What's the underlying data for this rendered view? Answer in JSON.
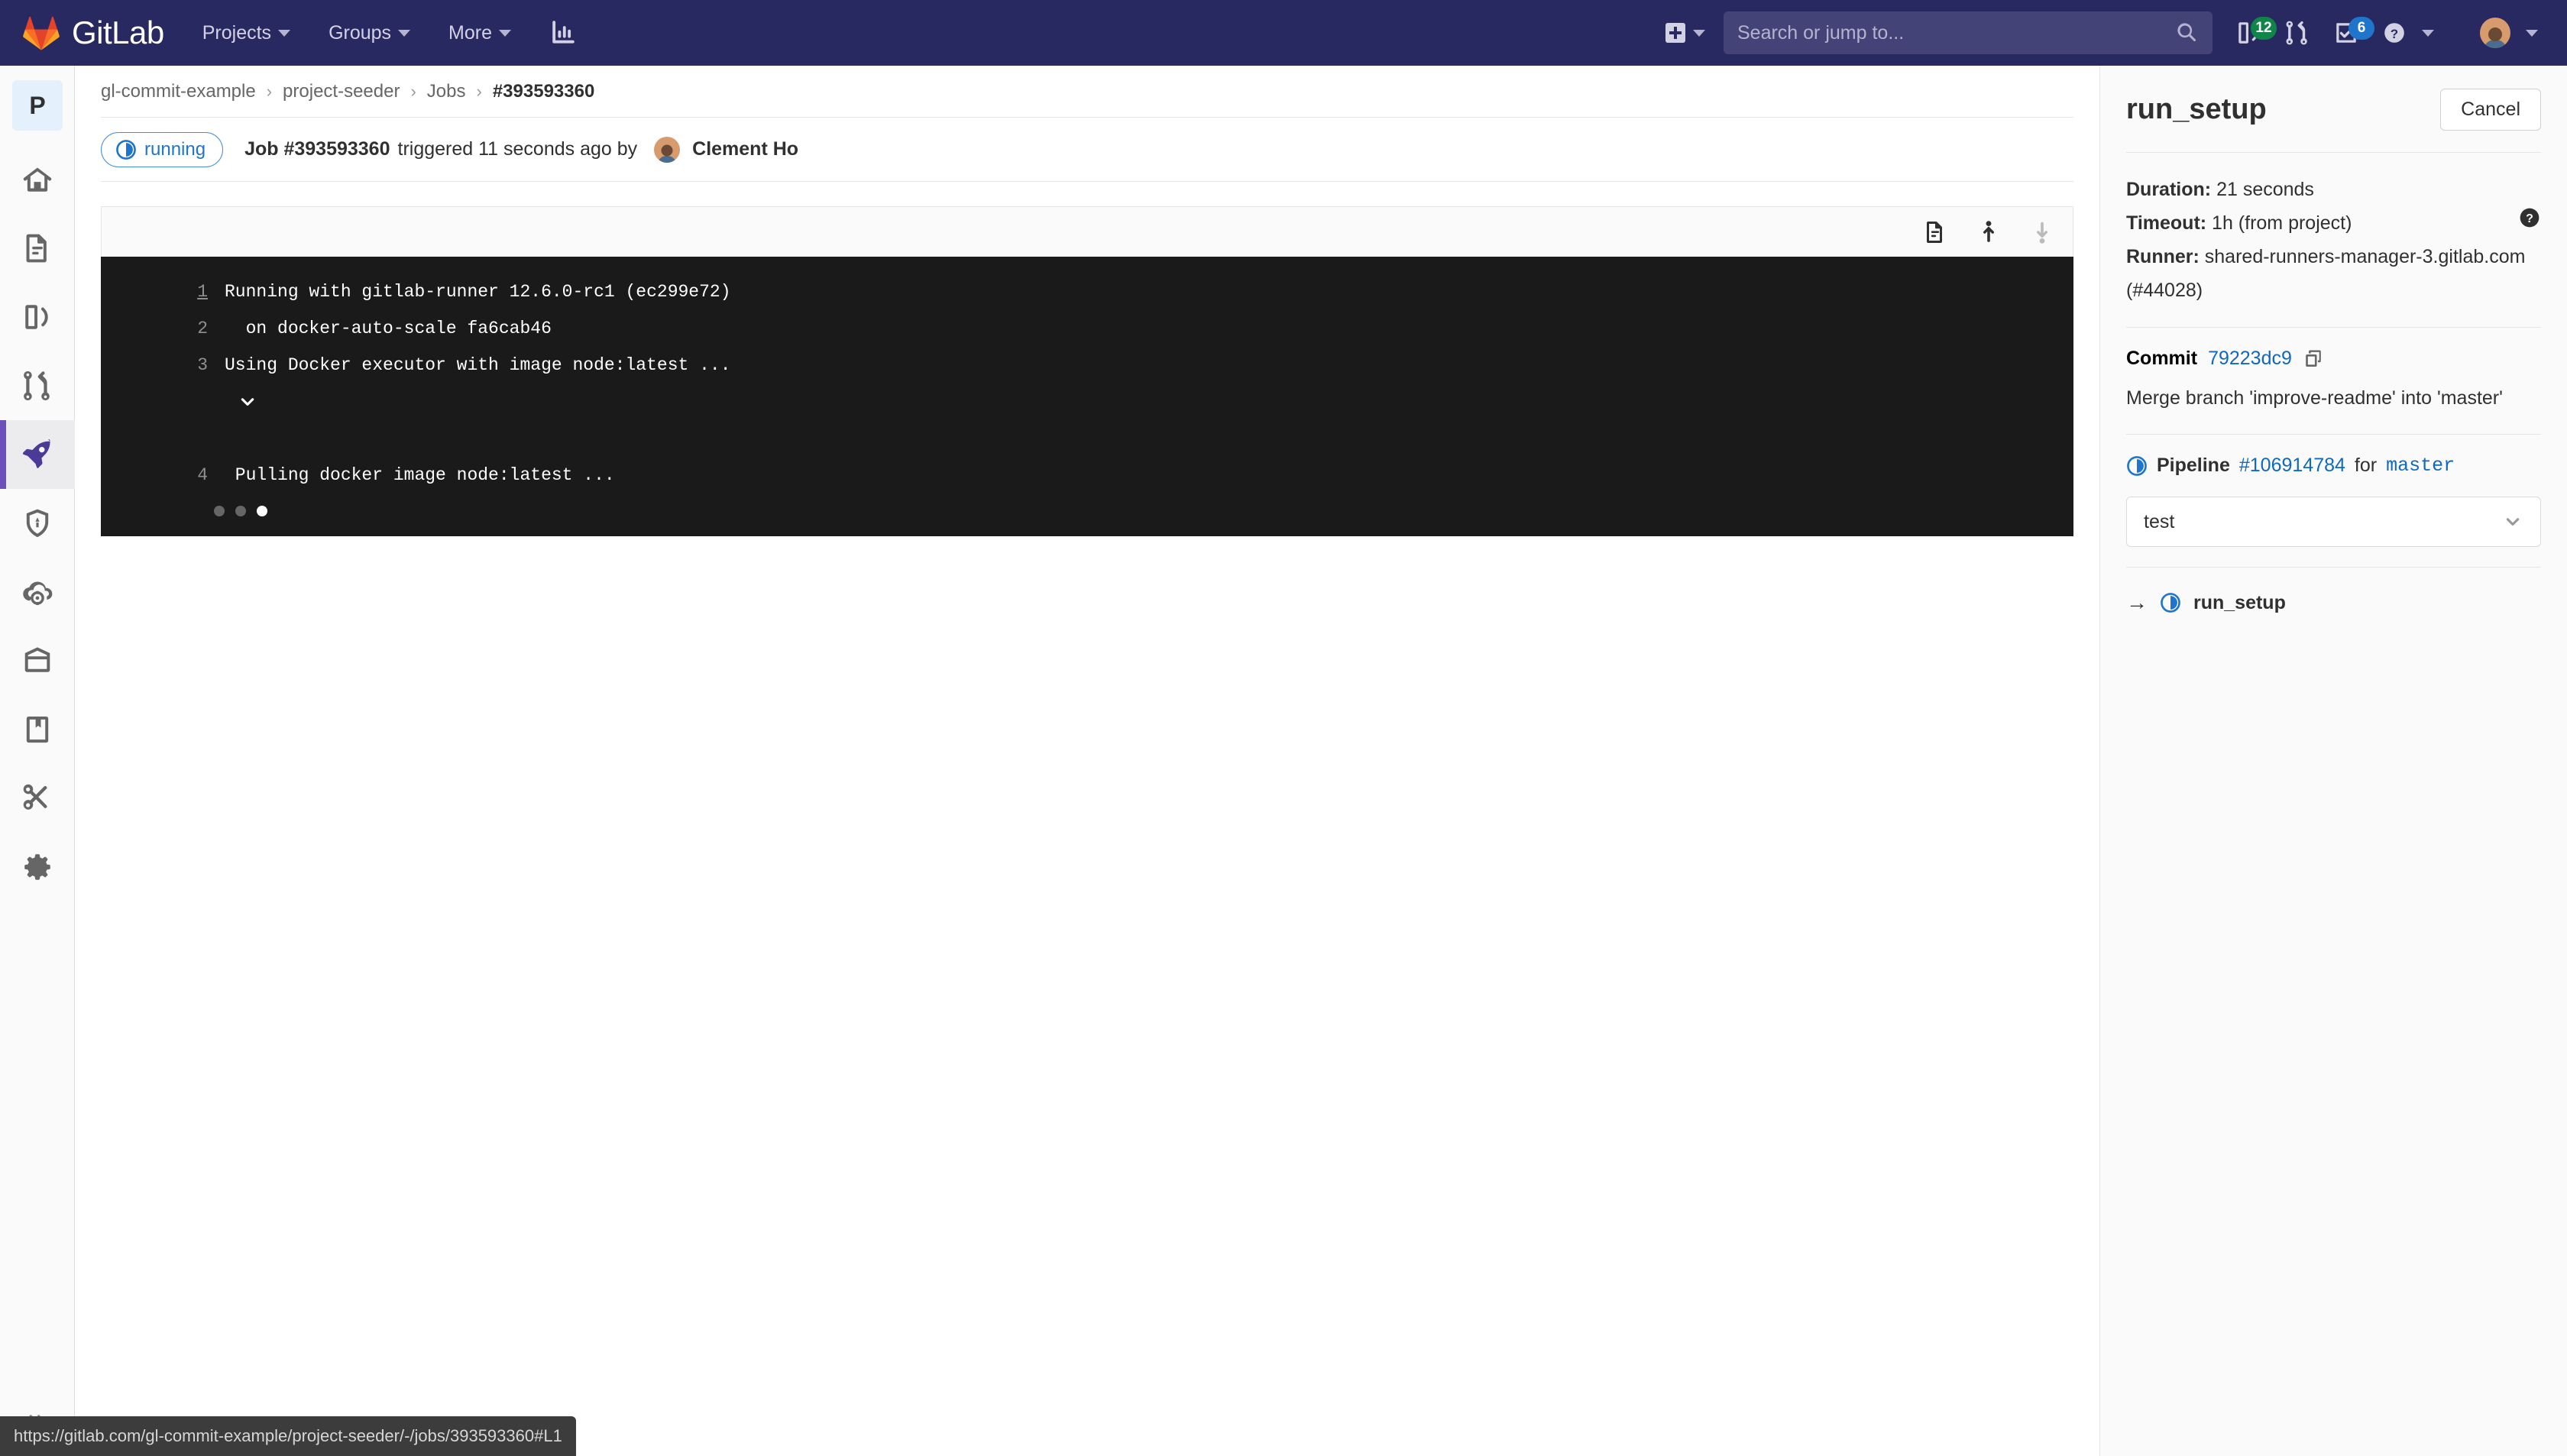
{
  "navbar": {
    "brand": "GitLab",
    "items": [
      {
        "label": "Projects",
        "name": "nav-projects"
      },
      {
        "label": "Groups",
        "name": "nav-groups"
      },
      {
        "label": "More",
        "name": "nav-more"
      }
    ],
    "analytics_icon": "bar-chart-icon",
    "plus_icon": "plus-icon",
    "search": {
      "placeholder": "Search or jump to...",
      "value": "",
      "icon": "search-icon"
    },
    "issues": {
      "icon": "issues-icon",
      "count": "12",
      "color": "#108548"
    },
    "merge_requests": {
      "icon": "merge-request-icon"
    },
    "todos": {
      "icon": "todo-checkbox-icon",
      "count": "6",
      "color": "#1f75cb"
    },
    "help": {
      "icon": "question-circle-icon"
    },
    "user": {
      "icon": "avatar"
    }
  },
  "sidebar": {
    "project_initial": "P",
    "items": [
      {
        "label": "Project overview",
        "icon": "home-icon",
        "active": false
      },
      {
        "label": "Repository",
        "icon": "document-icon",
        "active": false
      },
      {
        "label": "Issues",
        "icon": "issues-icon",
        "active": false
      },
      {
        "label": "Merge Requests",
        "icon": "merge-request-icon",
        "active": false
      },
      {
        "label": "CI/CD",
        "icon": "rocket-icon",
        "active": true
      },
      {
        "label": "Security & Compliance",
        "icon": "shield-icon",
        "active": false
      },
      {
        "label": "Operations",
        "icon": "cloud-gear-icon",
        "active": false
      },
      {
        "label": "Packages",
        "icon": "package-icon",
        "active": false
      },
      {
        "label": "Wiki",
        "icon": "book-icon",
        "active": false
      },
      {
        "label": "Snippets",
        "icon": "scissors-icon",
        "active": false
      },
      {
        "label": "Settings",
        "icon": "gear-icon",
        "active": false
      }
    ],
    "collapse_icon": "double-chevron-right-icon"
  },
  "breadcrumb": {
    "group": "gl-commit-example",
    "project": "project-seeder",
    "section": "Jobs",
    "current": "#393593360",
    "separator": "›"
  },
  "job_header": {
    "status": "running",
    "status_icon": "running-icon",
    "job_id": "Job #393593360",
    "triggered_text": "triggered 11 seconds ago by",
    "user": "Clement Ho"
  },
  "log": {
    "toolbar": [
      {
        "name": "raw-log-button",
        "icon": "document-icon"
      },
      {
        "name": "scroll-to-top-button",
        "icon": "arrow-up-icon"
      },
      {
        "name": "scroll-to-bottom-button",
        "icon": "arrow-down-icon"
      }
    ],
    "lines": [
      {
        "num": "1",
        "text": "Running with gitlab-runner 12.6.0-rc1 (ec299e72)",
        "toggle": "",
        "linked": true
      },
      {
        "num": "2",
        "text": "  on docker-auto-scale fa6cab46",
        "toggle": "",
        "linked": false
      },
      {
        "num": "3",
        "text": "Using Docker executor with image node:latest ...",
        "toggle": "chevron-down-icon",
        "linked": false
      },
      {
        "num": "4",
        "text": " Pulling docker image node:latest ...",
        "toggle": "",
        "linked": false
      }
    ],
    "loading_dots": 3
  },
  "right_sidebar": {
    "title": "run_setup",
    "cancel_label": "Cancel",
    "duration_label": "Duration:",
    "duration_value": "21 seconds",
    "timeout_label": "Timeout:",
    "timeout_value": "1h (from project)",
    "timeout_help_icon": "question-circle-filled-icon",
    "runner_label": "Runner:",
    "runner_value": "shared-runners-manager-3.gitlab.com (#44028)",
    "commit_label": "Commit",
    "commit_sha": "79223dc9",
    "copy_icon": "copy-icon",
    "commit_message": "Merge branch 'improve-readme' into 'master'",
    "pipeline_icon": "running-icon",
    "pipeline_label": "Pipeline",
    "pipeline_id": "#106914784",
    "pipeline_for": "for",
    "pipeline_ref": "master",
    "stage_selected": "test",
    "stage_chevron": "chevron-down-icon",
    "jobs": [
      {
        "arrow": "→",
        "icon": "running-icon",
        "name": "run_setup"
      }
    ]
  },
  "statusbar": {
    "url": "https://gitlab.com/gl-commit-example/project-seeder/-/jobs/393593360#L1"
  },
  "colors": {
    "navbar_bg": "#292961",
    "accent_blue": "#1f75cb",
    "link_blue": "#1068bf",
    "terminal_bg": "#1a1a1a",
    "active_purple": "#6b4fbb",
    "badge_green": "#108548"
  }
}
